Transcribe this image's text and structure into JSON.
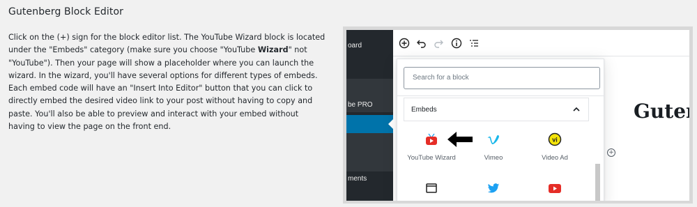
{
  "heading": "Gutenberg Block Editor",
  "description": {
    "part1": "Click on the (+) sign for the block editor list. The YouTube Wizard block is located under the \"Embeds\" category (make sure you choose \"YouTube ",
    "bold": "Wizard",
    "part2": "\" not \"YouTube\"). Then your page will show a placeholder where you can launch the wizard. In the wizard, you'll have several options for different types of embeds. Each embed code will have an \"Insert Into Editor\" button that you can click to directly embed the desired video link to your post without having to copy and paste. You'll also be able to preview and interact with your embed without having to view the page on the front end."
  },
  "screenshot": {
    "sidebar": {
      "items": [
        "oard",
        "be PRO",
        "ments"
      ]
    },
    "toolbar": {
      "icons": [
        "add-block-icon",
        "undo-icon",
        "redo-icon",
        "info-icon",
        "outline-icon"
      ]
    },
    "canvas": {
      "title": "Guten"
    },
    "inserter": {
      "search_placeholder": "Search for a block",
      "panel_title": "Embeds",
      "blocks": [
        {
          "label": "YouTube Wizard",
          "icon": "youtube-wizard-icon",
          "color": "#e52d27"
        },
        {
          "label": "Vimeo",
          "icon": "vimeo-icon",
          "color": "#1ab7ea"
        },
        {
          "label": "Video Ad",
          "icon": "video-ad-icon",
          "color": "#f4e409"
        },
        {
          "label": "",
          "icon": "embed-generic-icon",
          "color": "#555d66"
        },
        {
          "label": "",
          "icon": "twitter-icon",
          "color": "#1da1f2"
        },
        {
          "label": "",
          "icon": "youtube-icon",
          "color": "#e52d27"
        }
      ]
    }
  },
  "colors": {
    "admin_sidebar": "#23282d",
    "admin_active": "#0073aa",
    "page_background": "#f1f1f1"
  }
}
